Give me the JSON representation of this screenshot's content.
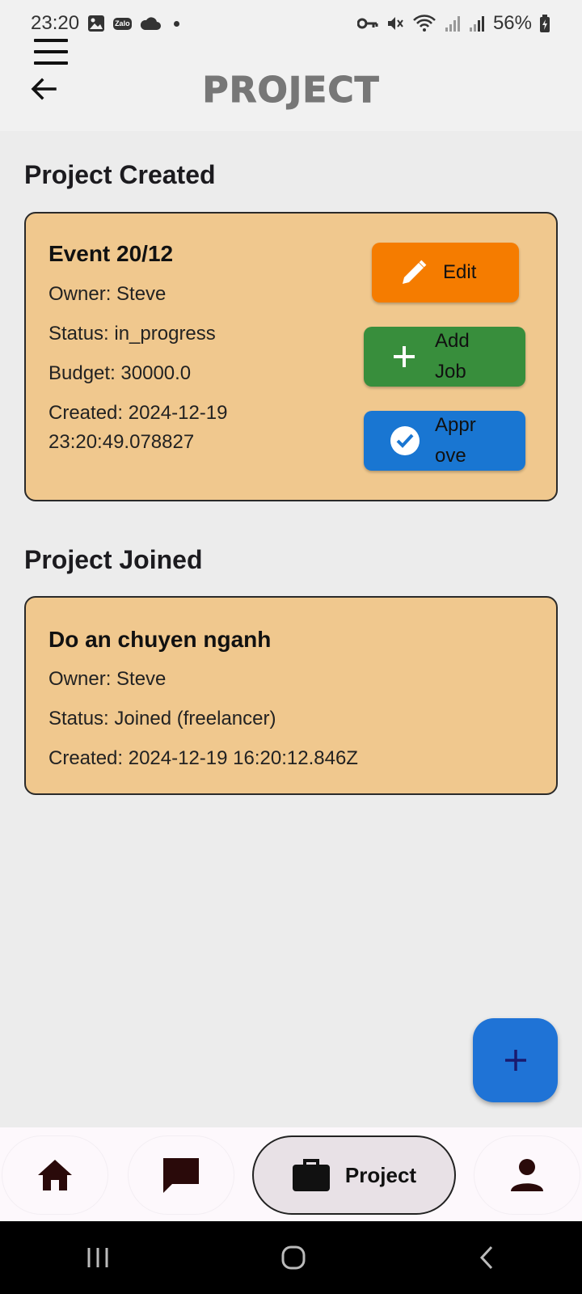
{
  "status_bar": {
    "time": "23:20",
    "left_icons": [
      "image-icon",
      "zalo-icon",
      "cloud-icon",
      "dot-icon"
    ],
    "zalo_text": "Zalo",
    "right_icons": [
      "key-icon",
      "mute-icon",
      "wifi-icon",
      "signal-icon",
      "signal-icon",
      "battery-icon"
    ],
    "battery": "56%"
  },
  "header": {
    "title": "PROJECT",
    "menu_icon": "menu-icon",
    "back_icon": "back-arrow-icon"
  },
  "created_section": {
    "title": "Project Created",
    "cards": [
      {
        "title": "Event 20/12",
        "owner": "Owner: Steve",
        "status": "Status: in_progress",
        "budget": "Budget: 30000.0",
        "created_line1": "Created: 2024-12-19",
        "created_line2": "23:20:49.078827",
        "buttons": {
          "edit": {
            "label": "Edit",
            "icon": "pencil-icon",
            "color": "#f57c00"
          },
          "add_job": {
            "label_line1": "Add",
            "label_line2": "Job",
            "icon": "plus-icon",
            "color": "#388e3c"
          },
          "approve": {
            "label_line1": "Appr",
            "label_line2": "ove",
            "icon": "check-circle-icon",
            "color": "#1976d2"
          }
        }
      }
    ]
  },
  "joined_section": {
    "title": "Project Joined",
    "cards": [
      {
        "title": "Do an chuyen nganh",
        "owner": "Owner: Steve",
        "status": "Status: Joined (freelancer)",
        "created": "Created: 2024-12-19 16:20:12.846Z"
      }
    ]
  },
  "fab": {
    "icon": "plus-icon",
    "color": "#1f73d6"
  },
  "bottom_nav": {
    "items": [
      {
        "icon": "home-icon"
      },
      {
        "icon": "chat-icon"
      },
      {
        "icon": "briefcase-icon",
        "label": "Project",
        "active": true
      },
      {
        "icon": "person-icon"
      }
    ]
  },
  "system_nav": [
    "recents-icon",
    "home-circle-icon",
    "back-chevron-icon"
  ],
  "colors": {
    "card_bg": "#f0c88e",
    "page_bg": "#ececec",
    "edit": "#f57c00",
    "add_job": "#388e3c",
    "approve": "#1976d2"
  }
}
